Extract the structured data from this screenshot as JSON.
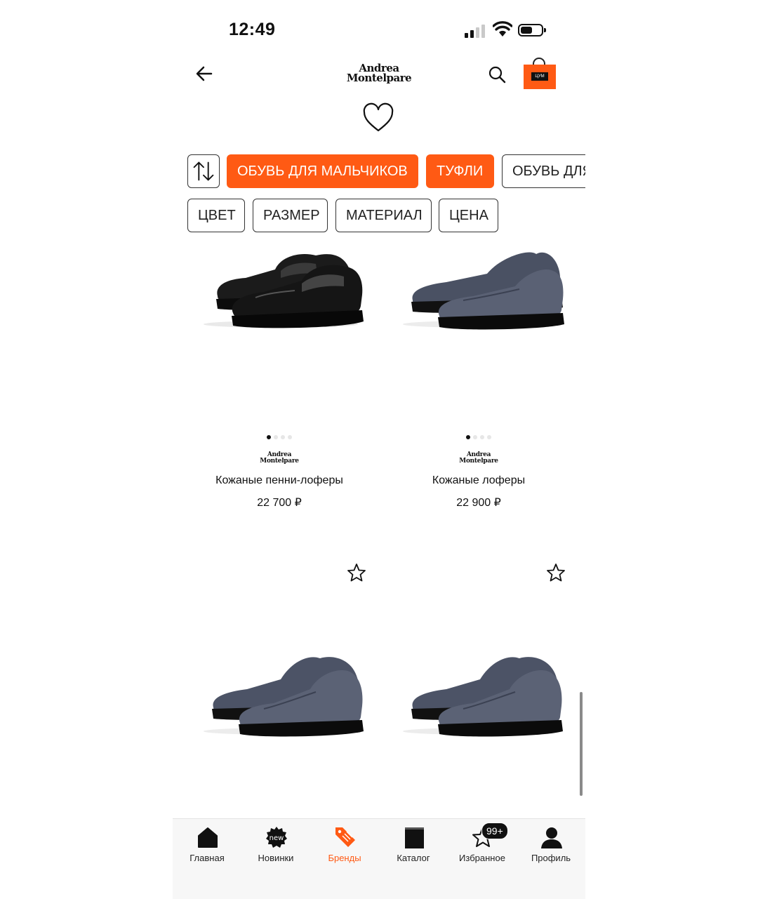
{
  "status_bar": {
    "time": "12:49"
  },
  "header": {
    "brand_line1": "Andrea",
    "brand_line2": "Montelpare",
    "cart_label": "ЦУМ"
  },
  "chips_row1": [
    {
      "label": "ОБУВЬ ДЛЯ МАЛЬЧИКОВ",
      "active": true
    },
    {
      "label": "ТУФЛИ",
      "active": true
    },
    {
      "label": "ОБУВЬ ДЛЯ",
      "active": false
    }
  ],
  "filters": [
    "ЦВЕТ",
    "РАЗМЕР",
    "МАТЕРИАЛ",
    "ЦЕНА"
  ],
  "products": [
    {
      "brand1": "Andrea",
      "brand2": "Montelpare",
      "name": "Кожаные пенни-лоферы",
      "price": "22 700 ₽",
      "color": "black"
    },
    {
      "brand1": "Andrea",
      "brand2": "Montelpare",
      "name": "Кожаные лоферы",
      "price": "22 900 ₽",
      "color": "grey-blue"
    },
    {
      "color": "grey-blue"
    },
    {
      "color": "grey-blue"
    }
  ],
  "tabbar": {
    "tabs": [
      {
        "label": "Главная",
        "icon": "home-icon"
      },
      {
        "label": "Новинки",
        "icon": "new-badge-icon",
        "icon_text": "new"
      },
      {
        "label": "Бренды",
        "icon": "tag-icon",
        "active": true
      },
      {
        "label": "Каталог",
        "icon": "book-icon"
      },
      {
        "label": "Избранное",
        "icon": "star-icon"
      },
      {
        "label": "Профиль",
        "icon": "person-icon"
      }
    ],
    "favorites_badge": "99+"
  },
  "colors": {
    "accent": "#ff5a14",
    "ink": "#111111"
  }
}
